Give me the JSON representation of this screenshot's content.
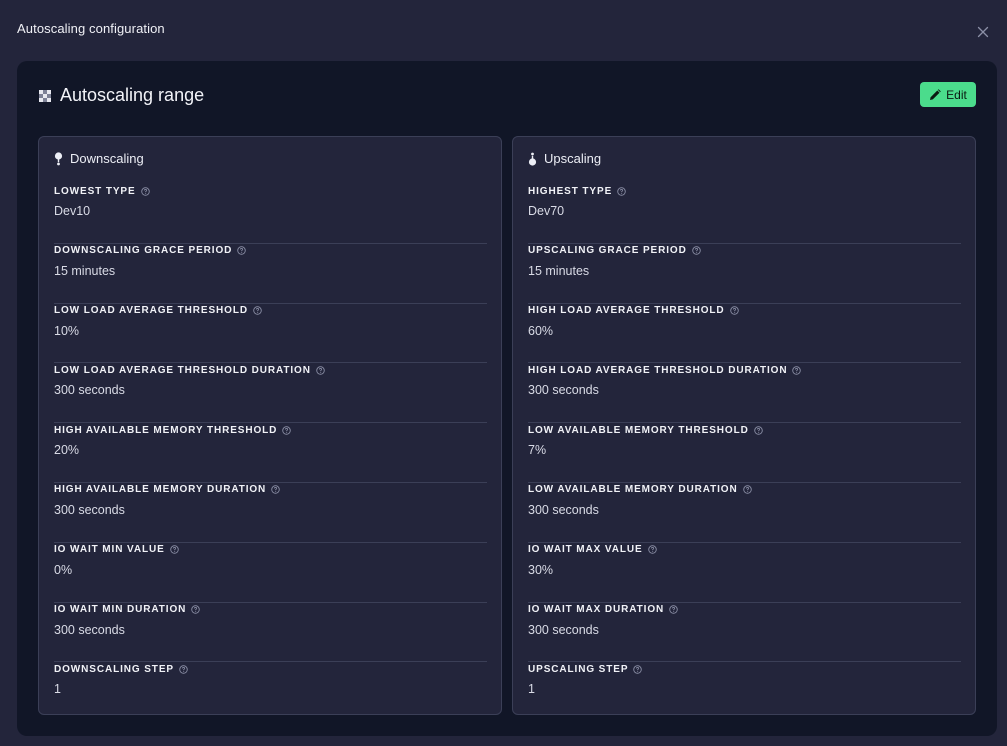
{
  "modal": {
    "title": "Autoscaling configuration"
  },
  "panel": {
    "title": "Autoscaling range",
    "edit_label": "Edit",
    "accent": "#4bdc8c"
  },
  "downscaling": {
    "title": "Downscaling",
    "rows": [
      {
        "label": "Lowest type",
        "value": "Dev10"
      },
      {
        "label": "Downscaling grace period",
        "value": "15 minutes"
      },
      {
        "label": "Low load average threshold",
        "value": "10%"
      },
      {
        "label": "Low load average threshold duration",
        "value": "300 seconds"
      },
      {
        "label": "High available memory threshold",
        "value": "20%"
      },
      {
        "label": "High available memory duration",
        "value": "300 seconds"
      },
      {
        "label": "IO wait min value",
        "value": "0%"
      },
      {
        "label": "IO wait min duration",
        "value": "300 seconds"
      },
      {
        "label": "Downscaling step",
        "value": "1"
      }
    ]
  },
  "upscaling": {
    "title": "Upscaling",
    "rows": [
      {
        "label": "Highest type",
        "value": "Dev70"
      },
      {
        "label": "Upscaling grace period",
        "value": "15 minutes"
      },
      {
        "label": "High load average threshold",
        "value": "60%"
      },
      {
        "label": "High load average threshold duration",
        "value": "300 seconds"
      },
      {
        "label": "Low available memory threshold",
        "value": "7%"
      },
      {
        "label": "Low available memory duration",
        "value": "300 seconds"
      },
      {
        "label": "IO wait max value",
        "value": "30%"
      },
      {
        "label": "IO wait max duration",
        "value": "300 seconds"
      },
      {
        "label": "Upscaling step",
        "value": "1"
      }
    ]
  },
  "icons": {
    "close": "close-icon",
    "range": "autoscaling-range-icon",
    "edit": "pencil-icon",
    "downscaling": "downscaling-icon",
    "upscaling": "upscaling-icon",
    "help": "help-circle-icon"
  }
}
